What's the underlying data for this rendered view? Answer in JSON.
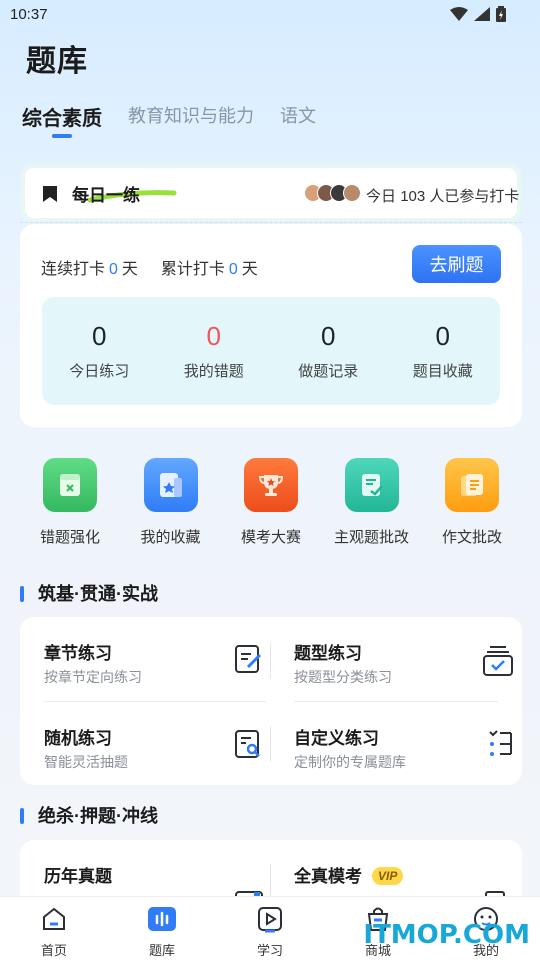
{
  "status_bar": {
    "time": "10:37"
  },
  "page": {
    "title": "题库"
  },
  "tabs": [
    {
      "label": "综合素质",
      "active": true
    },
    {
      "label": "教育知识与能力",
      "active": false
    },
    {
      "label": "语文",
      "active": false
    }
  ],
  "daily": {
    "title": "每日一练",
    "participants_prefix": "今日",
    "participants_count": "103",
    "participants_suffix": "人已参与打卡"
  },
  "streak": {
    "continuous_label": "连续打卡",
    "continuous_value": "0",
    "continuous_unit": "天",
    "total_label": "累计打卡",
    "total_value": "0",
    "total_unit": "天",
    "go_button": "去刷题"
  },
  "stats": [
    {
      "value": "0",
      "label": "今日练习"
    },
    {
      "value": "0",
      "label": "我的错题"
    },
    {
      "value": "0",
      "label": "做题记录"
    },
    {
      "value": "0",
      "label": "题目收藏"
    }
  ],
  "quick_actions": [
    {
      "label": "错题强化",
      "icon": "error-book-icon",
      "color": "#3fc46a"
    },
    {
      "label": "我的收藏",
      "icon": "favorite-icon",
      "color": "#3b8cff"
    },
    {
      "label": "模考大赛",
      "icon": "trophy-icon",
      "color": "#f0602a"
    },
    {
      "label": "主观题批改",
      "icon": "subjective-check-icon",
      "color": "#2fc0a4"
    },
    {
      "label": "作文批改",
      "icon": "essay-icon",
      "color": "#ffae1a"
    }
  ],
  "section1": {
    "title": "筑基·贯通·实战",
    "items": [
      {
        "title": "章节练习",
        "sub": "按章节定向练习"
      },
      {
        "title": "题型练习",
        "sub": "按题型分类练习"
      },
      {
        "title": "随机练习",
        "sub": "智能灵活抽题"
      },
      {
        "title": "自定义练习",
        "sub": "定制你的专属题库"
      }
    ]
  },
  "section2": {
    "title": "绝杀·押题·冲线",
    "items": [
      {
        "title": "历年真题"
      },
      {
        "title": "全真模考",
        "badge": "VIP"
      }
    ]
  },
  "bottom_nav": [
    {
      "label": "首页",
      "icon": "home-icon"
    },
    {
      "label": "题库",
      "icon": "question-bank-icon",
      "active": true
    },
    {
      "label": "学习",
      "icon": "study-icon"
    },
    {
      "label": "商城",
      "icon": "shop-icon"
    },
    {
      "label": "我的",
      "icon": "profile-icon"
    }
  ],
  "watermark": "ITMOP.COM",
  "colors": {
    "accent": "#2f7cf6",
    "error": "#f05656",
    "stats_bg": "#e3f6fa"
  }
}
